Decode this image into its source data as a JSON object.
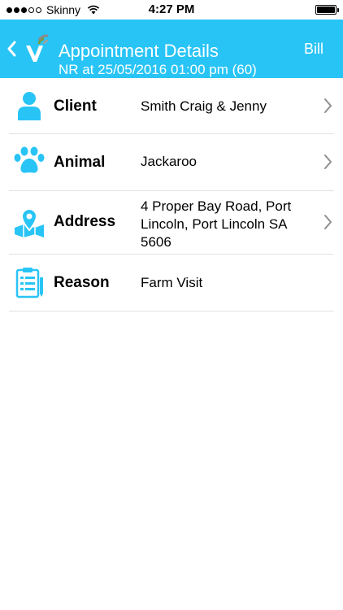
{
  "status_bar": {
    "carrier": "Skinny",
    "time": "4:27 PM"
  },
  "header": {
    "title": "Appointment Details",
    "subtitle": "NR at 25/05/2016 01:00 pm (60)",
    "action_label": "Bill",
    "back_icon": "chevron-left-icon",
    "logo": "vet-logo"
  },
  "colors": {
    "accent": "#29c4f6",
    "separator": "#e1e1e1",
    "chevron": "#8e8e93"
  },
  "details": [
    {
      "label": "Client",
      "value": "Smith Craig & Jenny",
      "icon": "person-icon",
      "has_chevron": true
    },
    {
      "label": "Animal",
      "value": "Jackaroo",
      "icon": "paw-icon",
      "has_chevron": true
    },
    {
      "label": "Address",
      "value": "4 Proper Bay Road, Port Lincoln, Port Lincoln SA 5606",
      "icon": "map-pin-icon",
      "has_chevron": true
    },
    {
      "label": "Reason",
      "value": "Farm Visit",
      "icon": "clipboard-icon",
      "has_chevron": false
    }
  ]
}
